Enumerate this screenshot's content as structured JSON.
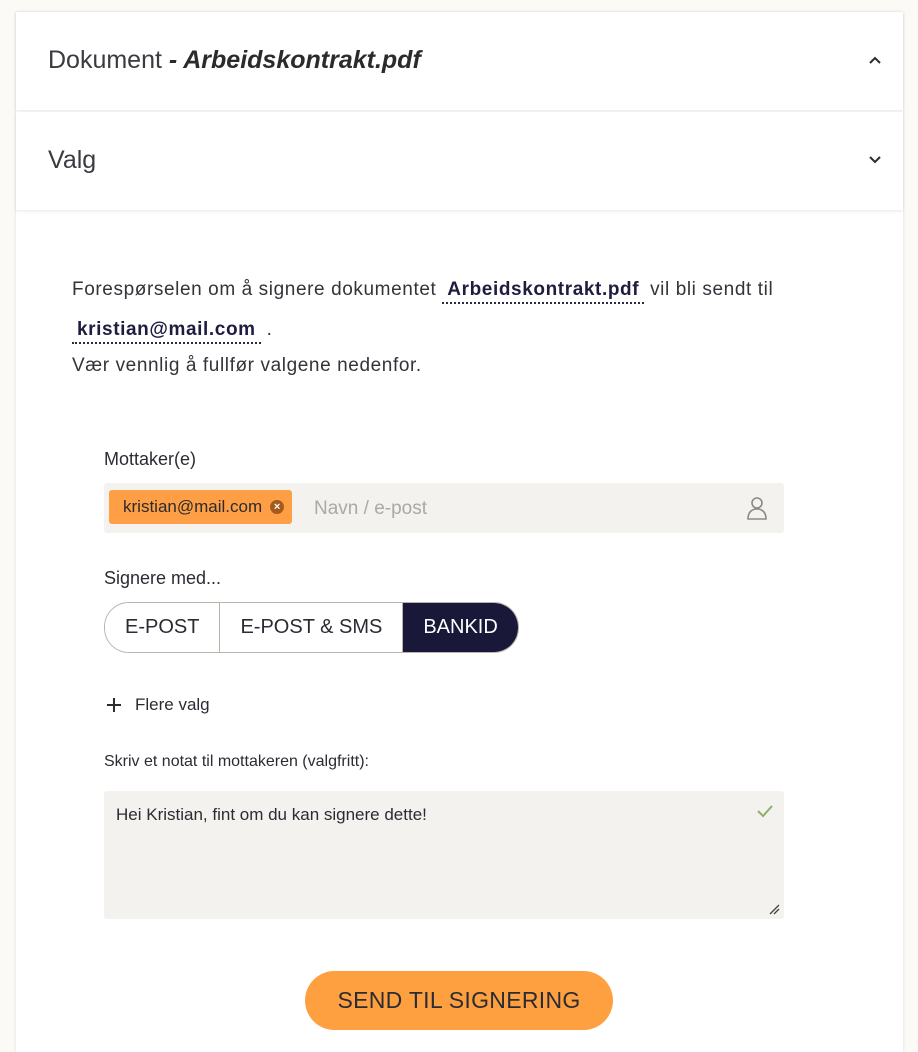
{
  "accordion": {
    "document": {
      "prefix": "Dokument",
      "separator": " - ",
      "filename": "Arbeidskontrakt.pdf"
    },
    "options": {
      "title": "Valg"
    }
  },
  "intro": {
    "text_before": "Forespørselen om å signere dokumentet",
    "document_name": "Arbeidskontrakt.pdf",
    "text_middle": "vil bli sendt til",
    "recipient_email": "kristian@mail.com",
    "period": ".",
    "instruction": "Vær vennlig å fullfør valgene nedenfor."
  },
  "recipients": {
    "label": "Mottaker(e)",
    "chips": [
      "kristian@mail.com"
    ],
    "remove_glyph": "×",
    "placeholder": "Navn / e-post",
    "icon": "person-icon"
  },
  "sign_with": {
    "label": "Signere med...",
    "options": [
      "E-POST",
      "E-POST & SMS",
      "BANKID"
    ],
    "selected": "BANKID"
  },
  "more_options": {
    "label": "Flere valg",
    "icon": "plus-icon"
  },
  "note": {
    "label": "Skriv et notat til mottakeren (valgfritt):",
    "value": "Hei Kristian, fint om du kan signere dette!"
  },
  "submit": {
    "label": "SEND TIL SIGNERING"
  },
  "colors": {
    "accent": "#ff9f45",
    "selected": "#1a1838",
    "field_bg": "#f3f2ee",
    "check": "#8fae6e"
  }
}
